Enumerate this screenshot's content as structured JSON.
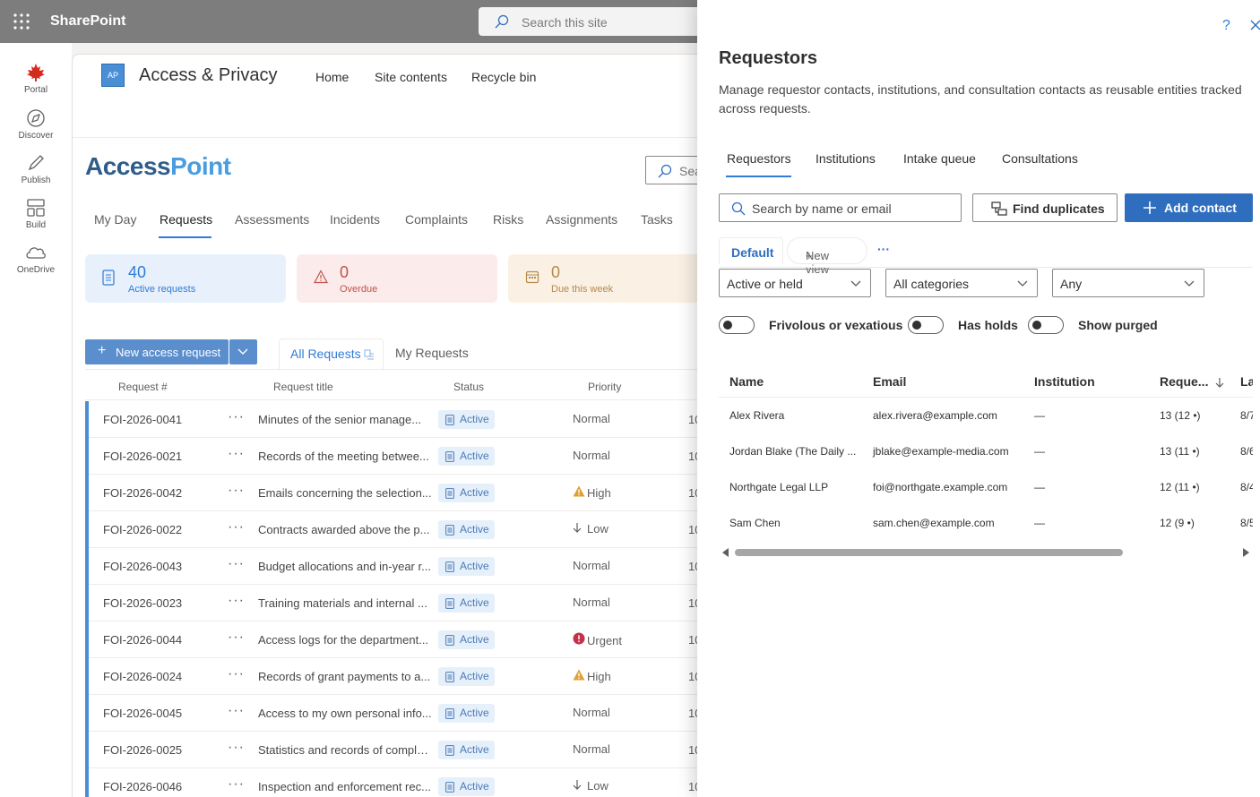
{
  "suitebar": {
    "brand": "SharePoint",
    "search_placeholder": "Search this site"
  },
  "app_rail": [
    {
      "label": "Portal",
      "icon": "maple-leaf-icon"
    },
    {
      "label": "Discover",
      "icon": "compass-icon"
    },
    {
      "label": "Publish",
      "icon": "pen-icon"
    },
    {
      "label": "Build",
      "icon": "grid-icon"
    },
    {
      "label": "OneDrive",
      "icon": "cloud-icon"
    }
  ],
  "site": {
    "logo_text": "AP",
    "title": "Access & Privacy",
    "nav": [
      "Home",
      "Site contents",
      "Recycle bin"
    ]
  },
  "app": {
    "logo_part1": "Access",
    "logo_part2": "Point",
    "search_placeholder": "Sea",
    "tabs": [
      "My Day",
      "Requests",
      "Assessments",
      "Incidents",
      "Complaints",
      "Risks",
      "Assignments",
      "Tasks"
    ],
    "selected_tab": "Requests",
    "kpis": [
      {
        "value": "40",
        "label": "Active requests",
        "color": "#2f7bd6",
        "bg": "#e8f1fb",
        "icon": "document-icon"
      },
      {
        "value": "0",
        "label": "Overdue",
        "color": "#c4504a",
        "bg": "#fbeceb",
        "icon": "warning-icon"
      },
      {
        "value": "0",
        "label": "Due this week",
        "color": "#b5894a",
        "bg": "#faf1e4",
        "icon": "calendar-icon"
      }
    ],
    "new_request_label": "New access request",
    "views": [
      "All Requests",
      "My Requests"
    ],
    "columns": [
      "Request #",
      "Request title",
      "Status",
      "Priority"
    ],
    "rows": [
      {
        "id": "FOI-2026-0041",
        "title": "Minutes of the senior manage...",
        "status": "Active",
        "priority": "Normal",
        "pri_icon": "",
        "date": "10"
      },
      {
        "id": "FOI-2026-0021",
        "title": "Records of the meeting betwee...",
        "status": "Active",
        "priority": "Normal",
        "pri_icon": "",
        "date": "10"
      },
      {
        "id": "FOI-2026-0042",
        "title": "Emails concerning the selection...",
        "status": "Active",
        "priority": "High",
        "pri_icon": "warning-icon",
        "date": "10"
      },
      {
        "id": "FOI-2026-0022",
        "title": "Contracts awarded above the p...",
        "status": "Active",
        "priority": "Low",
        "pri_icon": "arrow-down-icon",
        "date": "10"
      },
      {
        "id": "FOI-2026-0043",
        "title": "Budget allocations and in-year r...",
        "status": "Active",
        "priority": "Normal",
        "pri_icon": "",
        "date": "10"
      },
      {
        "id": "FOI-2026-0023",
        "title": "Training materials and internal ...",
        "status": "Active",
        "priority": "Normal",
        "pri_icon": "",
        "date": "10"
      },
      {
        "id": "FOI-2026-0044",
        "title": "Access logs for the department...",
        "status": "Active",
        "priority": "Urgent",
        "pri_icon": "alert-icon",
        "date": "10"
      },
      {
        "id": "FOI-2026-0024",
        "title": "Records of grant payments to a...",
        "status": "Active",
        "priority": "High",
        "pri_icon": "warning-icon",
        "date": "10"
      },
      {
        "id": "FOI-2026-0045",
        "title": "Access to my own personal info...",
        "status": "Active",
        "priority": "Normal",
        "pri_icon": "",
        "date": "10"
      },
      {
        "id": "FOI-2026-0025",
        "title": "Statistics and records of compla...",
        "status": "Active",
        "priority": "Normal",
        "pri_icon": "",
        "date": "10"
      },
      {
        "id": "FOI-2026-0046",
        "title": "Inspection and enforcement rec...",
        "status": "Active",
        "priority": "Low",
        "pri_icon": "arrow-down-icon",
        "date": "10"
      }
    ]
  },
  "panel": {
    "help": "?",
    "title": "Requestors",
    "description": "Manage requestor contacts, institutions, and consultation contacts as reusable entities tracked across requests.",
    "tabs": [
      "Requestors",
      "Institutions",
      "Intake queue",
      "Consultations"
    ],
    "search_placeholder": "Search by name or email",
    "find_duplicates_label": "Find duplicates",
    "add_contact_label": "Add contact",
    "view_default": "Default",
    "new_view_label": "New view",
    "more": "···",
    "filters": [
      "Active or held",
      "All categories",
      "Any"
    ],
    "toggles": [
      "Frivolous or vexatious",
      "Has holds",
      "Show purged"
    ],
    "columns": [
      "Name",
      "Email",
      "Institution",
      "Reque...",
      "La"
    ],
    "sort_icon": "arrow-down-icon",
    "rows": [
      {
        "name": "Alex Rivera",
        "email": "alex.rivera@example.com",
        "institution": "—",
        "requests": "13 (12 •)",
        "last": "8/7"
      },
      {
        "name": "Jordan Blake (The Daily ...",
        "email": "jblake@example-media.com",
        "institution": "—",
        "requests": "13 (11 •)",
        "last": "8/6"
      },
      {
        "name": "Northgate Legal LLP",
        "email": "foi@northgate.example.com",
        "institution": "—",
        "requests": "12 (11 •)",
        "last": "8/4"
      },
      {
        "name": "Sam Chen",
        "email": "sam.chen@example.com",
        "institution": "—",
        "requests": "12 (9 •)",
        "last": "8/5"
      }
    ]
  }
}
